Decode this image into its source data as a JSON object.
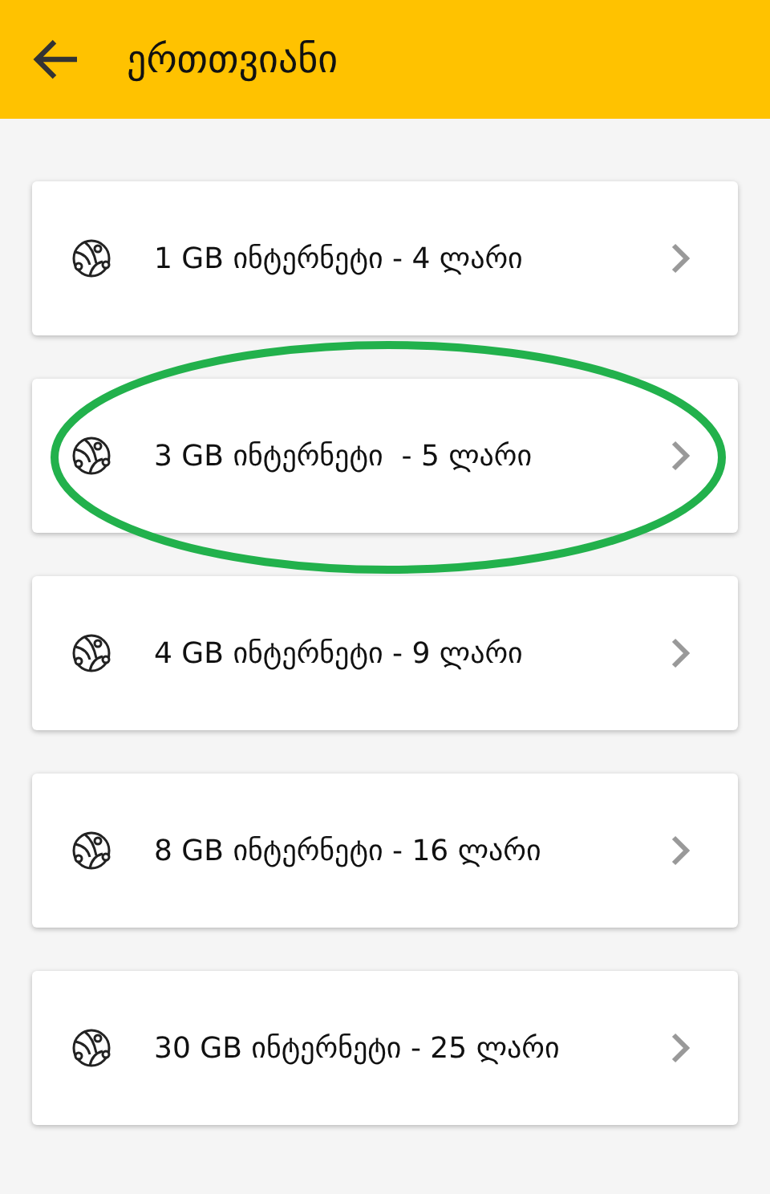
{
  "app_bar": {
    "title": "ერთთვიანი"
  },
  "items": [
    {
      "label": "1 GB ინტერნეტი - 4 ლარი",
      "highlighted": false
    },
    {
      "label": "3 GB ინტერნეტი  - 5 ლარი",
      "highlighted": true
    },
    {
      "label": "4 GB ინტერნეტი - 9 ლარი",
      "highlighted": false
    },
    {
      "label": "8 GB ინტერნეტი - 16 ლარი",
      "highlighted": false
    },
    {
      "label": "30 GB ინტერნეტი - 25 ლარი",
      "highlighted": false
    }
  ]
}
